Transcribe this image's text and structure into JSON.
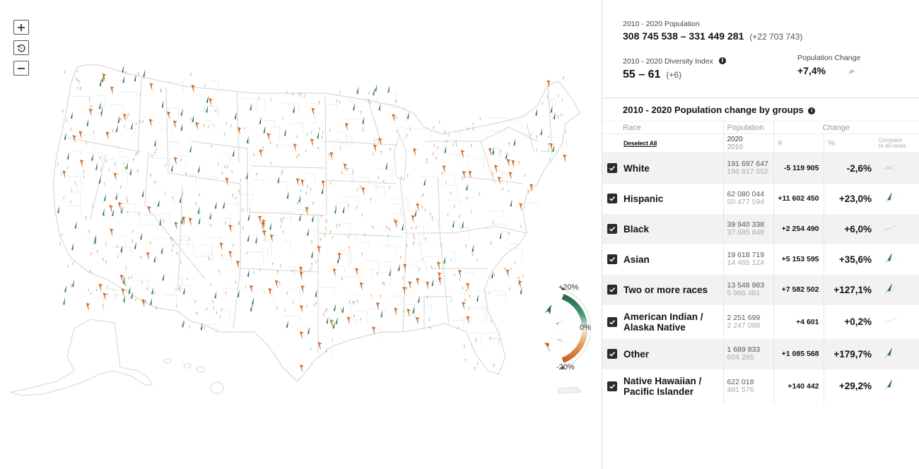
{
  "map": {
    "controls": {
      "zoom_in": "+",
      "reset": "reset",
      "zoom_out": "−"
    },
    "legend": {
      "top_label": "+20%",
      "mid_label": "0%",
      "bottom_label": "-20%",
      "positive_color": "#1e6b47",
      "mid_positive_color": "#7cc2a4",
      "neutral_color": "#e6e6e6",
      "mid_negative_color": "#efc08e",
      "negative_color": "#c8641e"
    },
    "colors": {
      "state_border": "#cfcfcf",
      "county_border": "#e5e5e5",
      "growth_strong": "#1e6b47",
      "growth_weak": "#7fb59b",
      "decline_strong": "#c8641e",
      "decline_weak": "#e9a978"
    }
  },
  "summary": {
    "population_label": "2010 - 2020 Population",
    "population_range": "308 745 538 – 331 449 281",
    "population_delta": "(+22 703 743)",
    "diversity_label": "2010 - 2020 Diversity Index",
    "diversity_range": "55 – 61",
    "diversity_delta": "(+6)",
    "change_label": "Population Change",
    "change_value": "+7,4%"
  },
  "groups": {
    "title": "2010 - 2020 Population change by groups",
    "headers": {
      "race": "Race",
      "population": "Population",
      "change": "Change",
      "deselect_all": "Deselect All",
      "year_new": "2020",
      "year_old": "2010",
      "num": "#",
      "pct": "%",
      "compare_1": "Compare",
      "compare_2": "to all races"
    },
    "rows": [
      {
        "name": "White",
        "pop2020": "191 697 647",
        "pop2010": "196 817 552",
        "change": "-5 119 905",
        "pct": "-2,6%",
        "checked": true,
        "trend": "decline-weak"
      },
      {
        "name": "Hispanic",
        "pop2020": "62 080 044",
        "pop2010": "50 477 594",
        "change": "+11 602 450",
        "pct": "+23,0%",
        "checked": true,
        "trend": "growth-strong"
      },
      {
        "name": "Black",
        "pop2020": "39 940 338",
        "pop2010": "37 685 848",
        "change": "+2 254 490",
        "pct": "+6,0%",
        "checked": true,
        "trend": "growth-weak"
      },
      {
        "name": "Asian",
        "pop2020": "19 618 719",
        "pop2010": "14 465 124",
        "change": "+5 153 595",
        "pct": "+35,6%",
        "checked": true,
        "trend": "growth-strong"
      },
      {
        "name": "Two or more races",
        "pop2020": "13 548 983",
        "pop2010": "5 966 481",
        "change": "+7 582 502",
        "pct": "+127,1%",
        "checked": true,
        "trend": "growth-strong"
      },
      {
        "name": "American Indian / Alaska Native",
        "pop2020": "2 251 699",
        "pop2010": "2 247 098",
        "change": "+4 601",
        "pct": "+0,2%",
        "checked": true,
        "trend": "neutral"
      },
      {
        "name": "Other",
        "pop2020": "1 689 833",
        "pop2010": "604 265",
        "change": "+1 085 568",
        "pct": "+179,7%",
        "checked": true,
        "trend": "growth-strong"
      },
      {
        "name": "Native Hawaiian / Pacific Islander",
        "pop2020": "622 018",
        "pop2010": "481 576",
        "change": "+140 442",
        "pct": "+29,2%",
        "checked": true,
        "trend": "growth-strong"
      }
    ]
  }
}
